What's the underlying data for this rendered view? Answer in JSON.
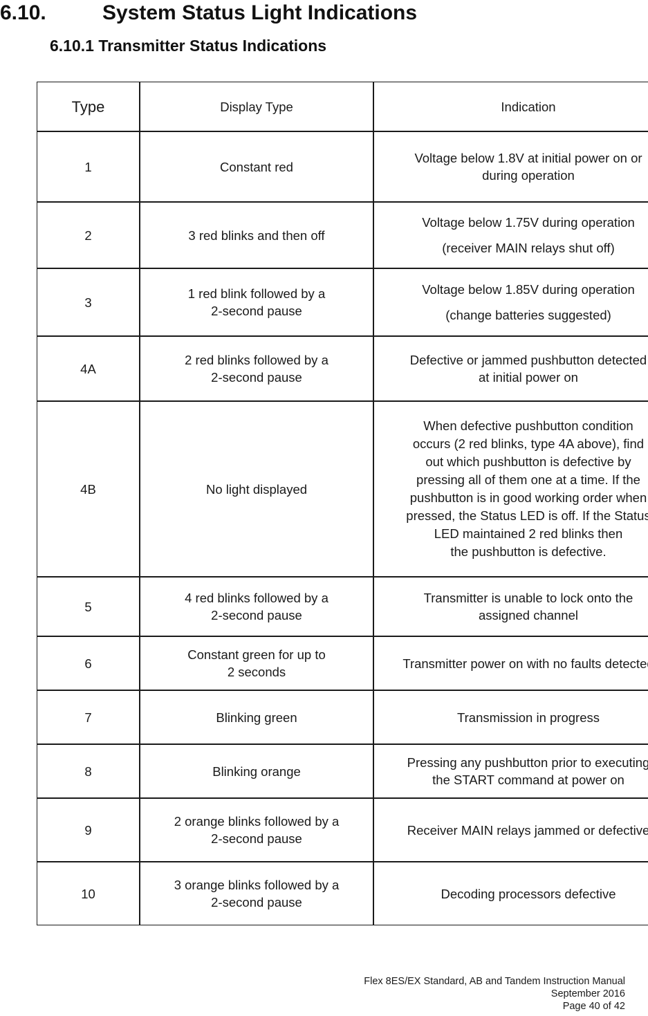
{
  "heading": {
    "number": "6.10.",
    "title": "System Status Light Indications",
    "sub": "6.10.1 Transmitter Status Indications"
  },
  "table": {
    "headers": {
      "type": "Type",
      "display_type": "Display Type",
      "indication": "Indication"
    },
    "rows": [
      {
        "type": "1",
        "display_line1": "Constant red",
        "display_line2": "",
        "ind_line1": "Voltage below 1.8V at initial power on or",
        "ind_line2": "during operation",
        "ind_line3": "",
        "ind_line4": "",
        "ind_line5": "",
        "ind_line6": "",
        "ind_line7": "",
        "ind_line8": ""
      },
      {
        "type": "2",
        "display_line1": "3 red blinks and then off",
        "display_line2": "",
        "ind_line1": "Voltage below 1.75V during operation",
        "ind_line2": "(receiver MAIN relays shut off)"
      },
      {
        "type": "3",
        "display_line1": "1 red blink followed by a",
        "display_line2": "2-second pause",
        "ind_line1": "Voltage below 1.85V during operation",
        "ind_line2": "(change batteries suggested)"
      },
      {
        "type": "4A",
        "display_line1": "2 red blinks followed by a",
        "display_line2": "2-second pause",
        "ind_line1": "Defective or jammed pushbutton detected",
        "ind_line2": "at initial power on"
      },
      {
        "type": "4B",
        "display_line1": "No light displayed",
        "display_line2": "",
        "ind_line1": "When defective pushbutton condition",
        "ind_line2": "occurs (2 red blinks, type 4A above), find",
        "ind_line3": "out which pushbutton is defective by",
        "ind_line4": "pressing all of them one at a time.  If the",
        "ind_line5": "pushbutton is in good working order when",
        "ind_line6": "pressed, the Status LED is off.  If the Status",
        "ind_line7": "LED maintained 2 red blinks then",
        "ind_line8": "the pushbutton is defective."
      },
      {
        "type": "5",
        "display_line1": "4 red blinks followed by a",
        "display_line2": "2-second pause",
        "ind_line1": "Transmitter is unable to lock onto the",
        "ind_line2": "assigned channel"
      },
      {
        "type": "6",
        "display_line1": "Constant green for up to",
        "display_line2": "2 seconds",
        "ind_line1": "Transmitter power on with no faults detected",
        "ind_line2": ""
      },
      {
        "type": "7",
        "display_line1": "Blinking green",
        "display_line2": "",
        "ind_line1": "Transmission in progress",
        "ind_line2": ""
      },
      {
        "type": "8",
        "display_line1": "Blinking orange",
        "display_line2": "",
        "ind_line1": "Pressing any pushbutton prior to executing",
        "ind_line2": "the START command at power on"
      },
      {
        "type": "9",
        "display_line1": "2 orange blinks followed by a",
        "display_line2": "2-second pause",
        "ind_line1": "Receiver MAIN relays jammed or defective",
        "ind_line2": ""
      },
      {
        "type": "10",
        "display_line1": "3 orange blinks followed by a",
        "display_line2": "2-second pause",
        "ind_line1": "Decoding processors defective",
        "ind_line2": ""
      }
    ]
  },
  "footer": {
    "line1": "Flex 8ES/EX Standard, AB and Tandem Instruction Manual",
    "line2": "September 2016",
    "line3": "Page 40 of 42"
  }
}
